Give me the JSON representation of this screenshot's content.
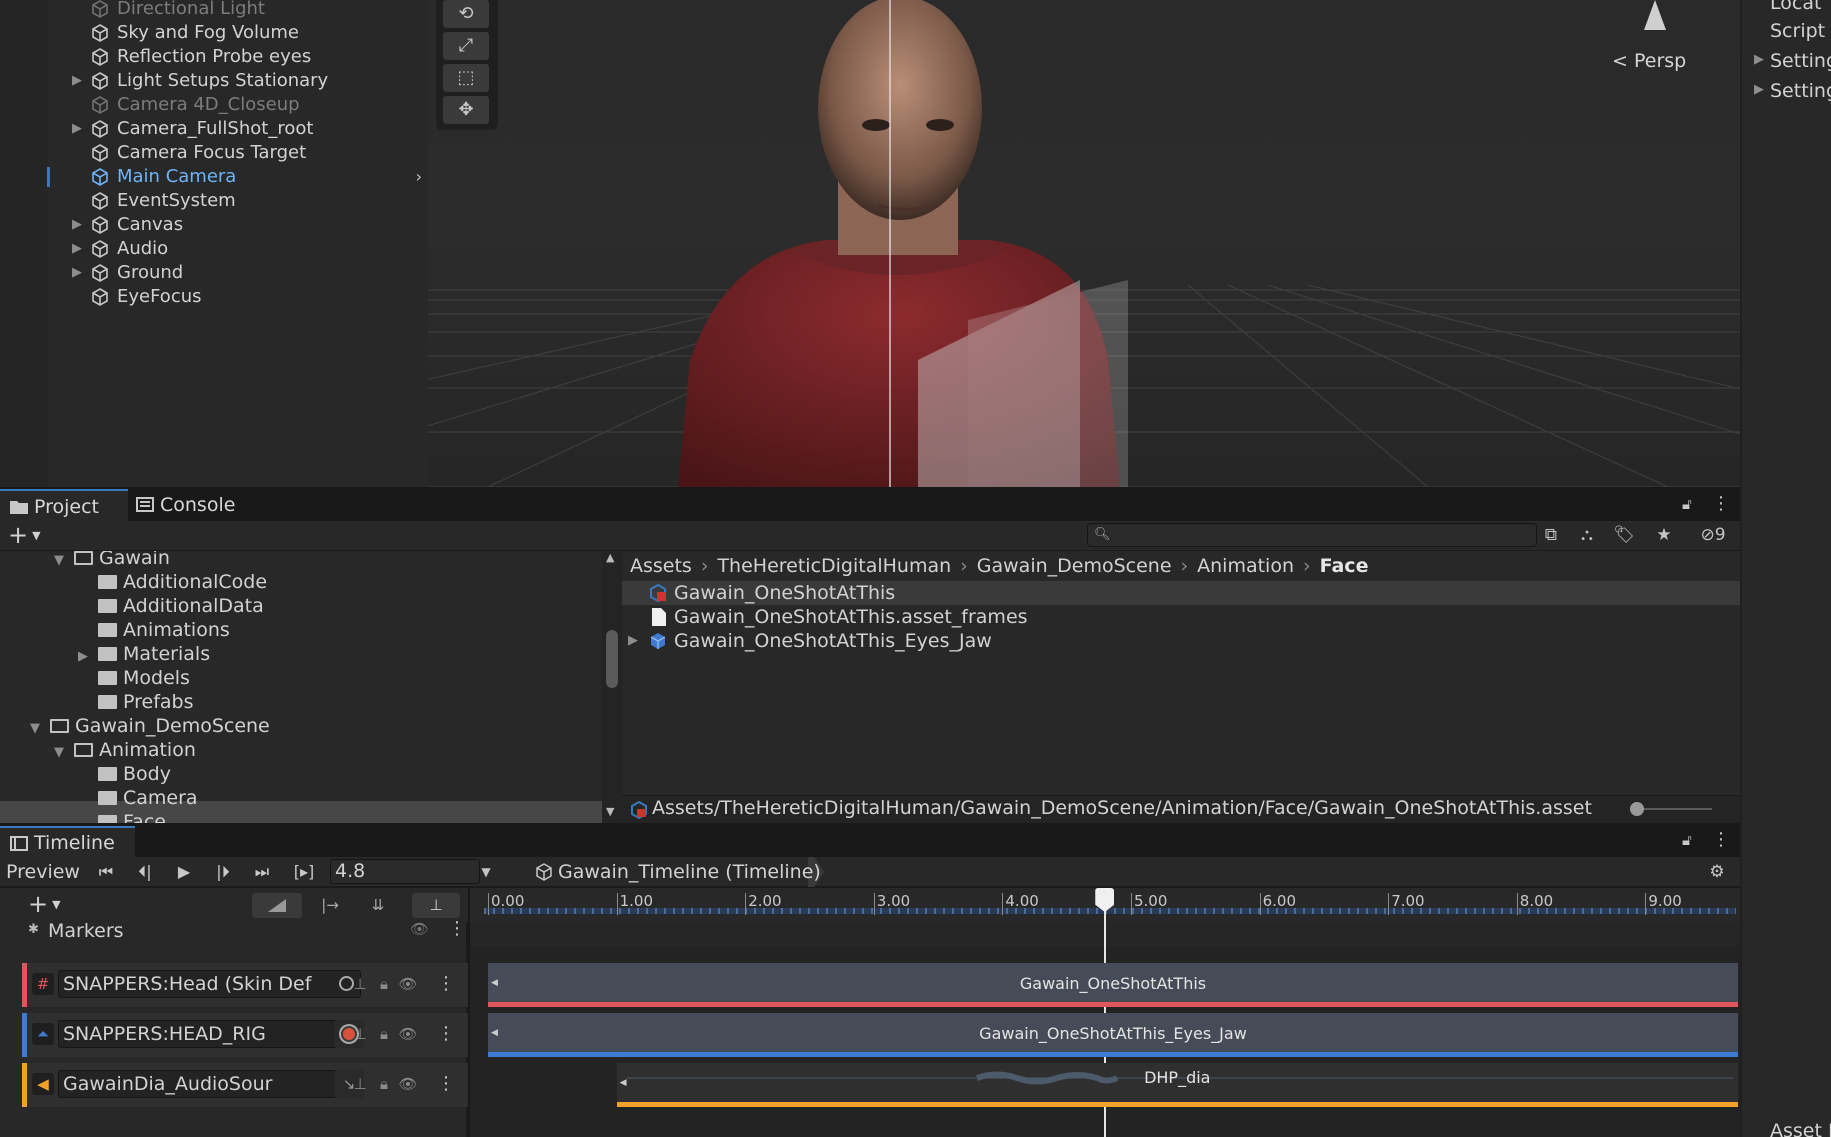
{
  "hierarchy": {
    "items": [
      {
        "label": "Directional Light",
        "state": "dim",
        "expandable": false
      },
      {
        "label": "Sky and Fog Volume",
        "state": "normal",
        "expandable": false
      },
      {
        "label": "Reflection Probe eyes",
        "state": "normal",
        "expandable": false
      },
      {
        "label": "Light Setups Stationary",
        "state": "normal",
        "expandable": true
      },
      {
        "label": "Camera 4D_Closeup",
        "state": "dim",
        "expandable": false
      },
      {
        "label": "Camera_FullShot_root",
        "state": "normal",
        "expandable": true
      },
      {
        "label": "Camera Focus Target",
        "state": "normal",
        "expandable": false
      },
      {
        "label": "Main Camera",
        "state": "selected",
        "expandable": false
      },
      {
        "label": "EventSystem",
        "state": "normal",
        "expandable": false
      },
      {
        "label": "Canvas",
        "state": "normal",
        "expandable": true
      },
      {
        "label": "Audio",
        "state": "normal",
        "expandable": true
      },
      {
        "label": "Ground",
        "state": "normal",
        "expandable": true
      },
      {
        "label": "EyeFocus",
        "state": "normal",
        "expandable": false
      }
    ]
  },
  "scene": {
    "projection_label": "Persp",
    "tools": [
      "rotate-tool",
      "scale-tool",
      "rect-tool",
      "transform-tool"
    ]
  },
  "inspector": {
    "items": [
      "Locat",
      "Script",
      "Setting",
      "Setting"
    ],
    "bottom_label": "Asset L"
  },
  "project": {
    "tabs": [
      {
        "label": "Project",
        "active": true
      },
      {
        "label": "Console",
        "active": false
      }
    ],
    "search_placeholder": "",
    "hidden_count": "9",
    "tree": [
      {
        "label": "Gawain",
        "indent": 2,
        "folder": "open",
        "expand": "open"
      },
      {
        "label": "AdditionalCode",
        "indent": 3,
        "folder": "closed",
        "expand": "none"
      },
      {
        "label": "AdditionalData",
        "indent": 3,
        "folder": "closed",
        "expand": "none"
      },
      {
        "label": "Animations",
        "indent": 3,
        "folder": "closed",
        "expand": "none"
      },
      {
        "label": "Materials",
        "indent": 3,
        "folder": "closed",
        "expand": "closed"
      },
      {
        "label": "Models",
        "indent": 3,
        "folder": "closed",
        "expand": "none"
      },
      {
        "label": "Prefabs",
        "indent": 3,
        "folder": "closed",
        "expand": "none"
      },
      {
        "label": "Gawain_DemoScene",
        "indent": 1,
        "folder": "open",
        "expand": "open"
      },
      {
        "label": "Animation",
        "indent": 2,
        "folder": "open",
        "expand": "open"
      },
      {
        "label": "Body",
        "indent": 3,
        "folder": "closed",
        "expand": "none"
      },
      {
        "label": "Camera",
        "indent": 3,
        "folder": "closed",
        "expand": "none"
      },
      {
        "label": "Face",
        "indent": 3,
        "folder": "closed",
        "expand": "none"
      }
    ],
    "breadcrumb": [
      "Assets",
      "TheHereticDigitalHuman",
      "Gawain_DemoScene",
      "Animation",
      "Face"
    ],
    "files": [
      {
        "label": "Gawain_OneShotAtThis",
        "type": "timeline",
        "selected": true,
        "expandable": false
      },
      {
        "label": "Gawain_OneShotAtThis.asset_frames",
        "type": "file",
        "selected": false,
        "expandable": false
      },
      {
        "label": "Gawain_OneShotAtThis_Eyes_Jaw",
        "type": "prefab",
        "selected": false,
        "expandable": true
      }
    ],
    "path": "Assets/TheHereticDigitalHuman/Gawain_DemoScene/Animation/Face/Gawain_OneShotAtThis.asset"
  },
  "timeline": {
    "tab_label": "Timeline",
    "preview_label": "Preview",
    "time_value": "4.8",
    "asset_label": "Gawain_Timeline (Timeline)",
    "ruler_ticks": [
      "0.00",
      "1.00",
      "2.00",
      "3.00",
      "4.00",
      "5.00",
      "6.00",
      "7.00",
      "8.00",
      "9.00"
    ],
    "playhead_time": 4.8,
    "markers_label": "Markers",
    "tracks": [
      {
        "binding": "SNAPPERS:Head (Skin Def",
        "color": "#e0575b",
        "icon": "hash-icon",
        "clip": "Gawain_OneShotAtThis",
        "clip_start": 0.0,
        "clip_end": 9.72,
        "bar_color": "#e0575b"
      },
      {
        "binding": "SNAPPERS:HEAD_RIG",
        "color": "#3e7ad1",
        "icon": "animation-icon",
        "clip": "Gawain_OneShotAtThis_Eyes_Jaw",
        "clip_start": 0.0,
        "clip_end": 9.72,
        "bar_color": "#3e7ad1"
      },
      {
        "binding": "GawainDia_AudioSour",
        "color": "#f1a22a",
        "icon": "audio-icon",
        "clip": "DHP_dia",
        "clip_start": 1.0,
        "clip_end": 9.72,
        "bar_color": "#f1a22a"
      }
    ]
  },
  "colors": {
    "accent": "#3a79bb",
    "selected_text": "#6fb3f7"
  }
}
